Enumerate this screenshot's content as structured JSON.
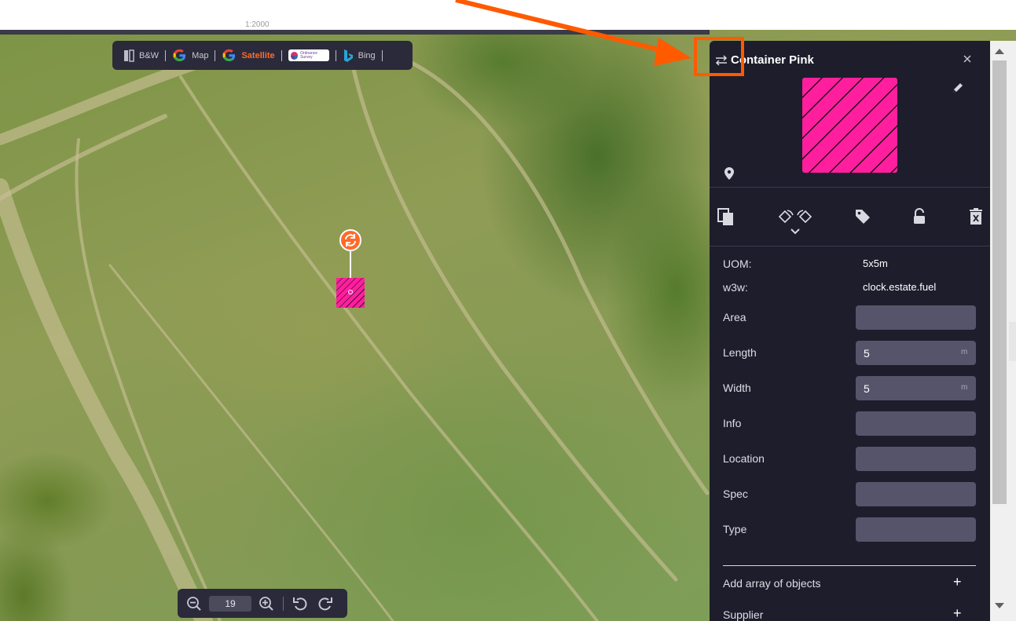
{
  "top": {
    "tiny_text": "1:2000"
  },
  "layers": [
    {
      "label": "B&W",
      "icon": "bw-map-icon",
      "active": false
    },
    {
      "label": "Map",
      "icon": "google-logo-icon",
      "active": false
    },
    {
      "label": "Satellite",
      "icon": "google-logo-icon",
      "active": true
    },
    {
      "label": "Ordnance Survey",
      "icon": "ordnance-survey-logo-icon",
      "active": false
    },
    {
      "label": "Bing",
      "icon": "bing-logo-icon",
      "active": false
    }
  ],
  "zoom": {
    "level": "19"
  },
  "panel": {
    "title": "Container Pink",
    "object_color": "#ff1f9e",
    "properties_text": [
      {
        "label": "UOM:",
        "value": "5x5m"
      },
      {
        "label": "w3w:",
        "value": "clock.estate.fuel"
      }
    ],
    "properties_fields": [
      {
        "label": "Area",
        "value": "",
        "unit": ""
      },
      {
        "label": "Length",
        "value": "5",
        "unit": "m"
      },
      {
        "label": "Width",
        "value": "5",
        "unit": "m"
      },
      {
        "label": "Info",
        "value": "",
        "unit": ""
      },
      {
        "label": "Location",
        "value": "",
        "unit": ""
      },
      {
        "label": "Spec",
        "value": "",
        "unit": ""
      },
      {
        "label": "Type",
        "value": "",
        "unit": ""
      }
    ],
    "sections": [
      {
        "label": "Add array of objects",
        "action": "+"
      },
      {
        "label": "Supplier",
        "action": "+"
      }
    ]
  },
  "colors": {
    "accent": "#ff6a2b",
    "panel_bg": "#1e1d2c",
    "annotation": "#ff5a00"
  }
}
